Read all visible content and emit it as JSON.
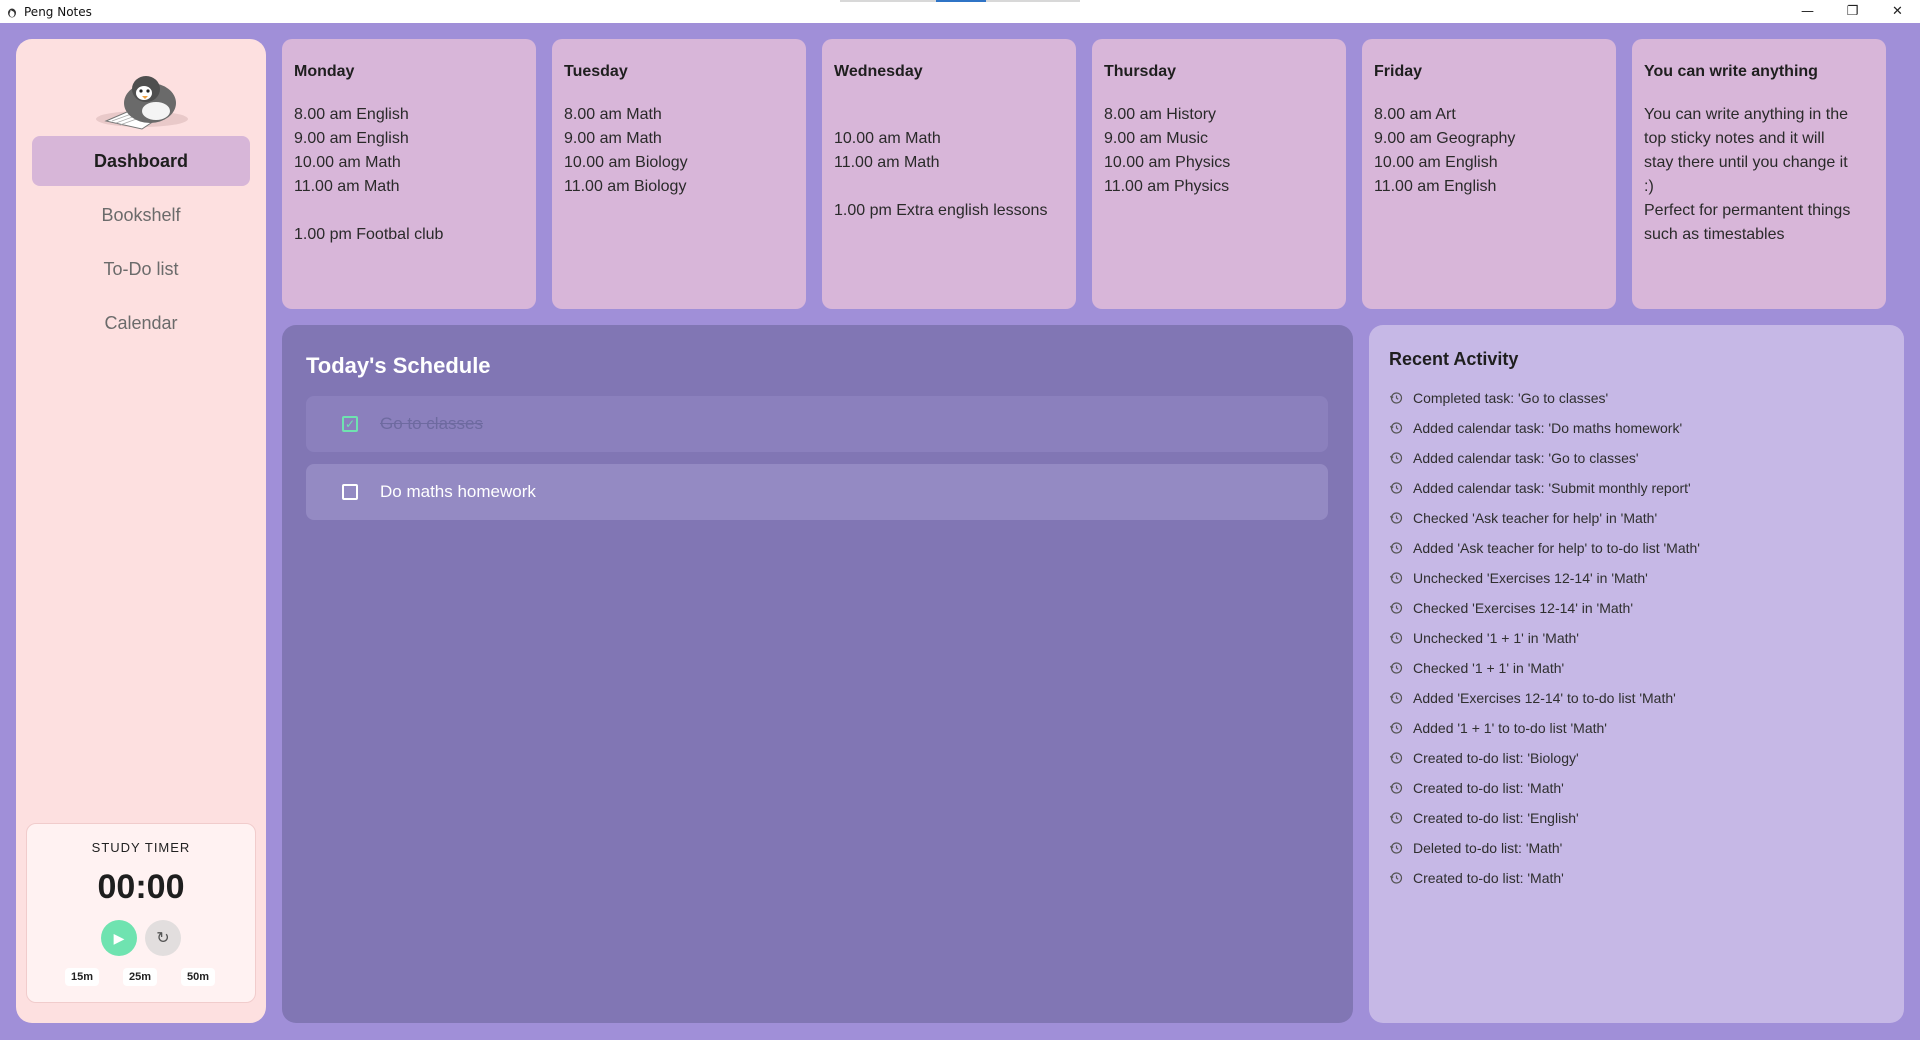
{
  "window": {
    "title": "Peng Notes",
    "controls": [
      "—",
      "❐",
      "✕"
    ]
  },
  "sidebar": {
    "nav": [
      {
        "label": "Dashboard",
        "active": true
      },
      {
        "label": "Bookshelf",
        "active": false
      },
      {
        "label": "To-Do list",
        "active": false
      },
      {
        "label": "Calendar",
        "active": false
      }
    ],
    "timer": {
      "label": "STUDY TIMER",
      "time": "00:00",
      "presets": [
        "15m",
        "25m",
        "50m"
      ]
    }
  },
  "notes": [
    {
      "title": "Monday",
      "lines": [
        "8.00 am English",
        "9.00 am English",
        "10.00 am Math",
        "11.00 am Math",
        "",
        "1.00 pm Footbal club"
      ]
    },
    {
      "title": "Tuesday",
      "lines": [
        "8.00 am Math",
        "9.00 am Math",
        "10.00 am Biology",
        "11.00 am Biology"
      ]
    },
    {
      "title": "Wednesday",
      "lines": [
        "",
        "10.00 am Math",
        "11.00 am Math",
        "",
        "1.00 pm Extra english lessons"
      ]
    },
    {
      "title": "Thursday",
      "lines": [
        "8.00 am History",
        "9.00 am Music",
        "10.00 am Physics",
        "11.00 am Physics"
      ]
    },
    {
      "title": "Friday",
      "lines": [
        "8.00 am Art",
        "9.00 am Geography",
        "10.00 am English",
        "11.00 am English"
      ]
    },
    {
      "title": "You can write anything",
      "lines": [
        "You can write anything in the",
        "top sticky notes and it will",
        "stay there until you change it",
        ":)",
        "Perfect for permantent things",
        "such as timestables"
      ]
    }
  ],
  "schedule": {
    "title": "Today's Schedule",
    "tasks": [
      {
        "label": "Go to classes",
        "done": true
      },
      {
        "label": "Do maths homework",
        "done": false
      }
    ]
  },
  "activity": {
    "title": "Recent Activity",
    "items": [
      "Completed task: 'Go to classes'",
      "Added calendar task: 'Do maths homework'",
      "Added calendar task: 'Go to classes'",
      "Added calendar task: 'Submit monthly report'",
      "Checked 'Ask teacher for help' in 'Math'",
      "Added 'Ask teacher for help' to to-do list 'Math'",
      "Unchecked 'Exercises 12-14' in 'Math'",
      "Checked 'Exercises 12-14' in 'Math'",
      "Unchecked '1 + 1' in 'Math'",
      "Checked '1 + 1' in 'Math'",
      "Added 'Exercises 12-14' to to-do list 'Math'",
      "Added '1 + 1' to to-do list 'Math'",
      "Created to-do list: 'Biology'",
      "Created to-do list: 'Math'",
      "Created to-do list: 'English'",
      "Deleted to-do list: 'Math'",
      "Created to-do list: 'Math'"
    ]
  },
  "colors": {
    "background": "#a08fd8",
    "sidebar": "#fde0e0",
    "note": "#d8b6d9",
    "schedule": "#8176b4",
    "activity": "#c6b8e6",
    "accent": "#6fe3b0"
  }
}
